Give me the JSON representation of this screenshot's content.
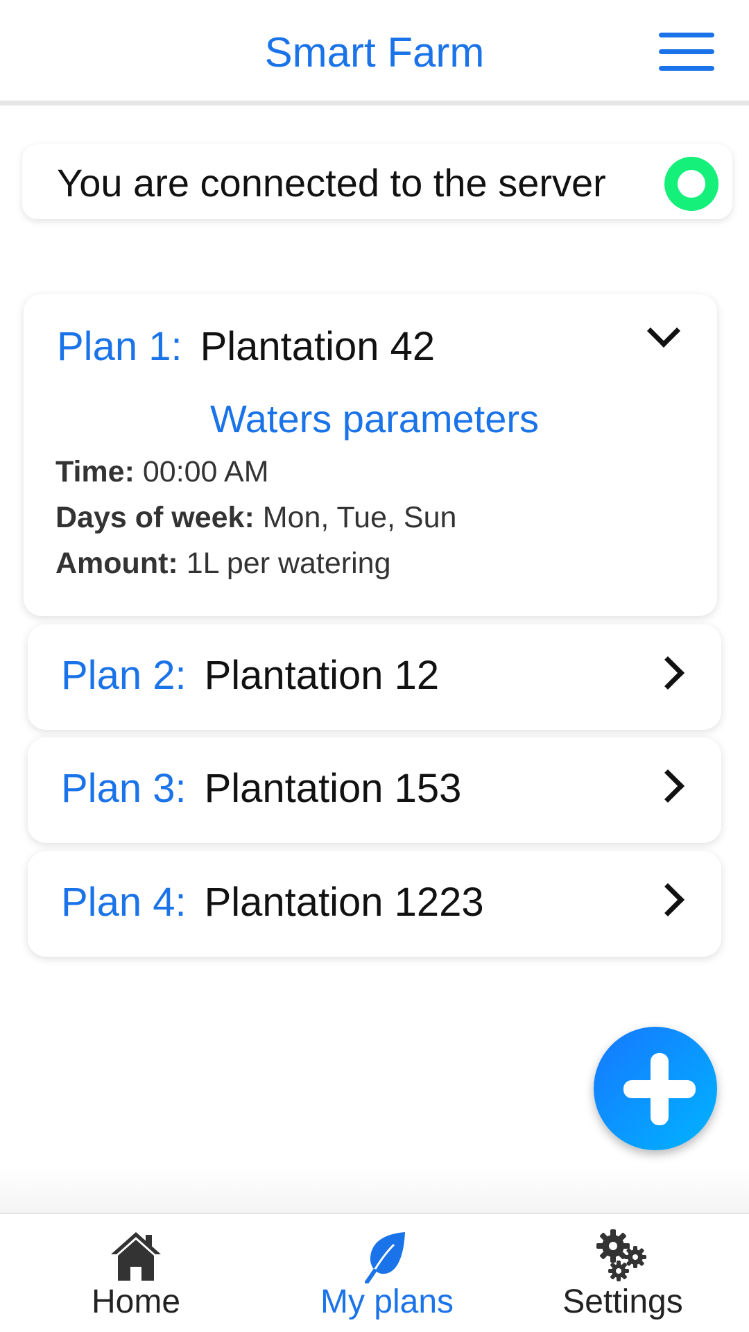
{
  "header": {
    "title": "Smart Farm",
    "menu_icon": "hamburger-menu-icon"
  },
  "status": {
    "text": "You are connected to the server",
    "indicator_color": "#14f07a"
  },
  "plans": [
    {
      "label": "Plan 1:",
      "name": "Plantation 42",
      "expanded": true,
      "params_title": "Waters parameters",
      "params": [
        {
          "key": "Time:",
          "value": "00:00 AM"
        },
        {
          "key": "Days of week:",
          "value": "Mon, Tue, Sun"
        },
        {
          "key": "Amount:",
          "value": "1L per watering"
        }
      ]
    },
    {
      "label": "Plan 2:",
      "name": "Plantation 12",
      "expanded": false
    },
    {
      "label": "Plan 3:",
      "name": "Plantation 153",
      "expanded": false
    },
    {
      "label": "Plan 4:",
      "name": "Plantation 1223",
      "expanded": false
    }
  ],
  "fab": {
    "icon": "plus-icon"
  },
  "nav": {
    "items": [
      {
        "label": "Home",
        "icon": "home-icon",
        "active": false
      },
      {
        "label": "My plans",
        "icon": "leaf-icon",
        "active": true
      },
      {
        "label": "Settings",
        "icon": "gears-icon",
        "active": false
      }
    ]
  },
  "colors": {
    "accent": "#1a73e8",
    "status_green": "#14f07a",
    "text": "#111111"
  }
}
